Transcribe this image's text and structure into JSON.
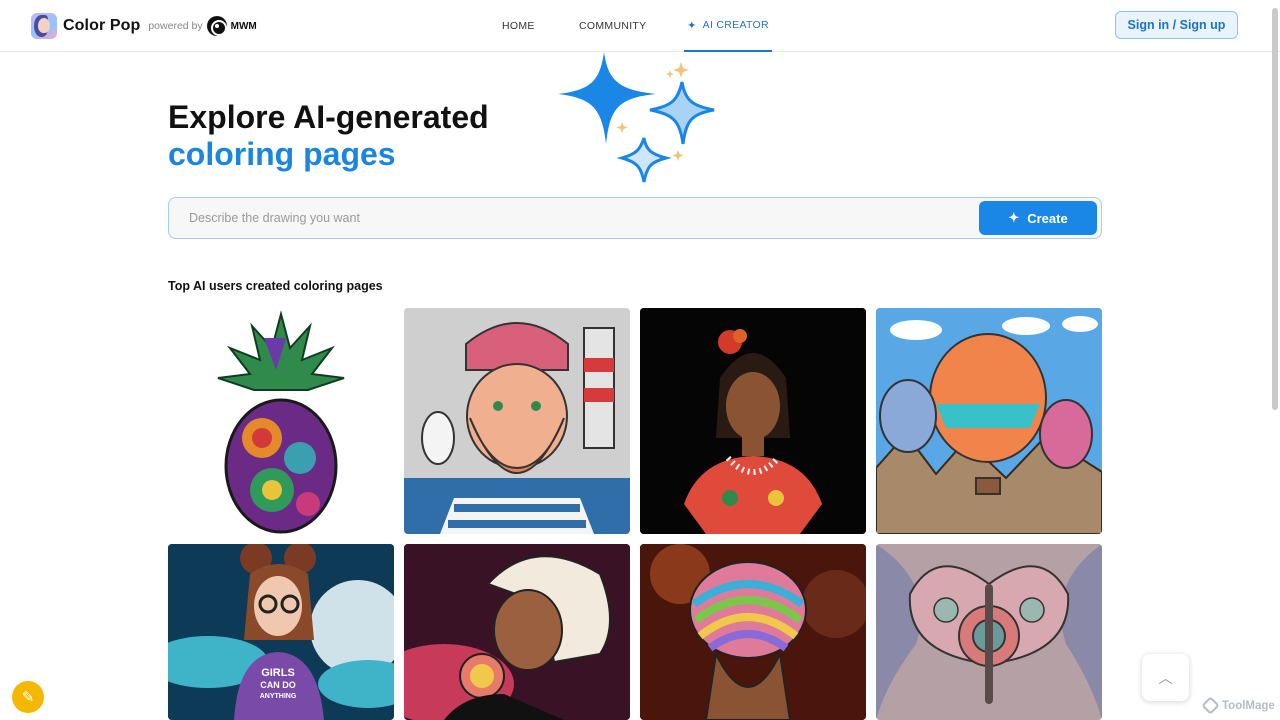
{
  "brand": {
    "name": "Color Pop",
    "powered_by": "powered by",
    "partner": "MWM"
  },
  "nav": {
    "home": "HOME",
    "community": "COMMUNITY",
    "ai_creator": "AI CREATOR"
  },
  "auth": {
    "signin_label": "Sign in / Sign up"
  },
  "hero": {
    "title": "Explore AI-generated",
    "subtitle": "coloring pages"
  },
  "prompt": {
    "placeholder": "Describe the drawing you want",
    "value": "",
    "create_label": "Create"
  },
  "gallery": {
    "title": "Top AI users created coloring pages",
    "items": [
      {
        "subject": "pineapple mandala"
      },
      {
        "subject": "bearded sailor with lighthouse"
      },
      {
        "subject": "woman with flower in hair"
      },
      {
        "subject": "hot air balloons over mountains"
      },
      {
        "subject": "girl with glasses in front of moon",
        "shirt_text": [
          "GIRLS",
          "CAN DO",
          "ANYTHING"
        ]
      },
      {
        "subject": "blonde woman drinking"
      },
      {
        "subject": "rainbow hair bun"
      },
      {
        "subject": "butterfly mandala"
      }
    ]
  },
  "watermark": "ToolMage",
  "colors": {
    "accent": "#1a86e6",
    "brand_blue": "#1976d2",
    "signin_bg": "#e8f3fc"
  }
}
